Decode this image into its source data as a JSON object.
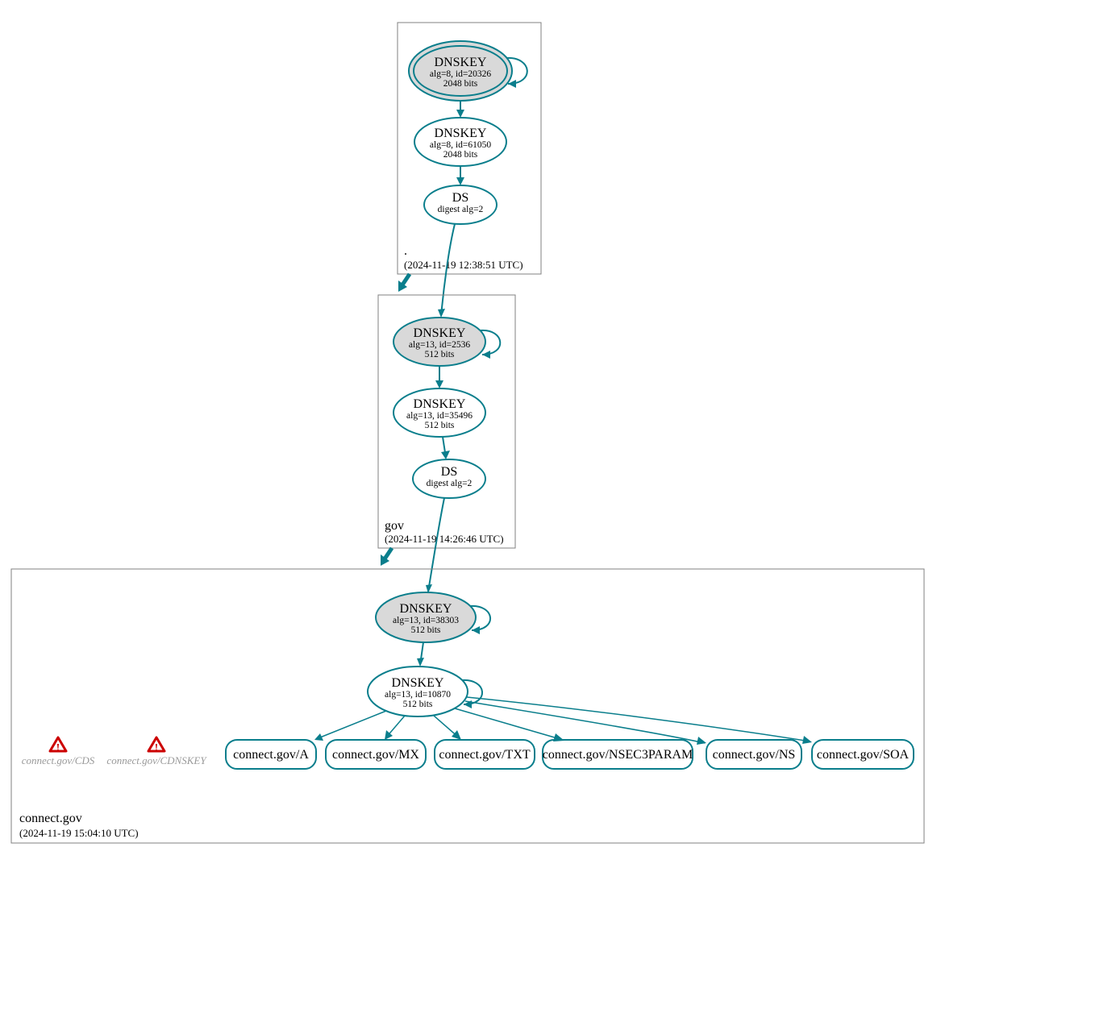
{
  "colors": {
    "accent": "#0a7e8c",
    "fill_grey": "#d9d9d9",
    "box_stroke": "#808080",
    "warn": "#cc0000",
    "warn_text": "#999999"
  },
  "zones": {
    "root": {
      "label": ".",
      "timestamp": "(2024-11-19 12:38:51 UTC)",
      "dnskey_ksk": {
        "title": "DNSKEY",
        "line1": "alg=8, id=20326",
        "line2": "2048 bits"
      },
      "dnskey_zsk": {
        "title": "DNSKEY",
        "line1": "alg=8, id=61050",
        "line2": "2048 bits"
      },
      "ds": {
        "title": "DS",
        "line1": "digest alg=2"
      }
    },
    "gov": {
      "label": "gov",
      "timestamp": "(2024-11-19 14:26:46 UTC)",
      "dnskey_ksk": {
        "title": "DNSKEY",
        "line1": "alg=13, id=2536",
        "line2": "512 bits"
      },
      "dnskey_zsk": {
        "title": "DNSKEY",
        "line1": "alg=13, id=35496",
        "line2": "512 bits"
      },
      "ds": {
        "title": "DS",
        "line1": "digest alg=2"
      }
    },
    "connect_gov": {
      "label": "connect.gov",
      "timestamp": "(2024-11-19 15:04:10 UTC)",
      "dnskey_ksk": {
        "title": "DNSKEY",
        "line1": "alg=13, id=38303",
        "line2": "512 bits"
      },
      "dnskey_zsk": {
        "title": "DNSKEY",
        "line1": "alg=13, id=10870",
        "line2": "512 bits"
      },
      "rrsets": {
        "a": "connect.gov/A",
        "mx": "connect.gov/MX",
        "txt": "connect.gov/TXT",
        "nsec3param": "connect.gov/NSEC3PARAM",
        "ns": "connect.gov/NS",
        "soa": "connect.gov/SOA"
      },
      "warnings": {
        "cds": "connect.gov/CDS",
        "cdnskey": "connect.gov/CDNSKEY"
      }
    }
  }
}
